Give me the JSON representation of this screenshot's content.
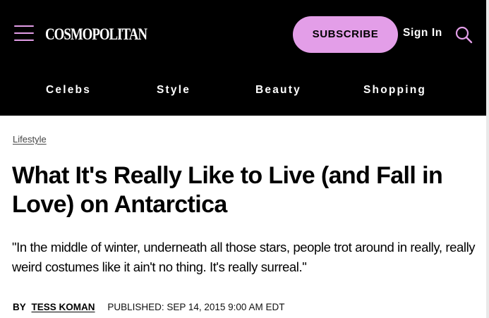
{
  "header": {
    "logo_text": "COSMOPOLITAN",
    "subscribe_label": "SUBSCRIBE",
    "signin_label": "Sign In",
    "accent_color": "#e39ee8",
    "icons": [
      "menu-icon",
      "search-icon"
    ]
  },
  "nav": {
    "items": [
      {
        "label": "Celebs"
      },
      {
        "label": "Style"
      },
      {
        "label": "Beauty"
      },
      {
        "label": "Shopping"
      }
    ]
  },
  "article": {
    "category": "Lifestyle",
    "title": "What It's Really Like to Live (and Fall in Love) on Antarctica",
    "dek": "\"In the middle of winter, underneath all those stars, people trot around in really, really weird costumes like it ain't no thing. It's really surreal.\"",
    "byline_prefix": "BY",
    "author": "TESS KOMAN",
    "published": "PUBLISHED: SEP 14, 2015 9:00 AM EDT"
  }
}
